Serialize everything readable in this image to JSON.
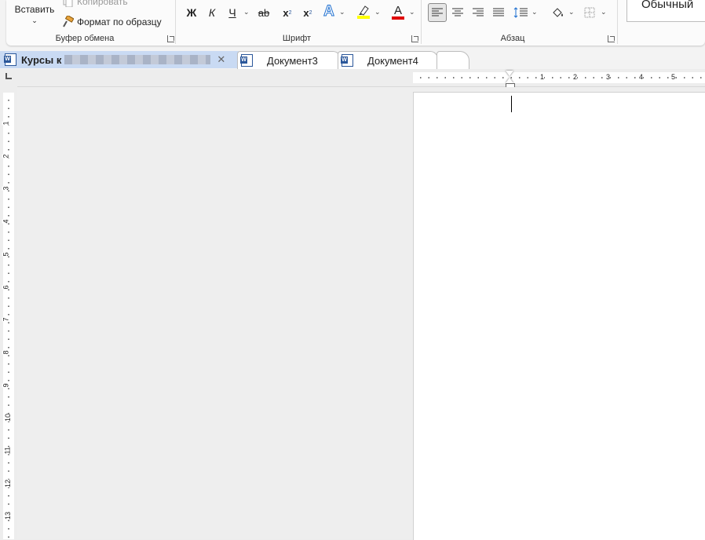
{
  "ribbon": {
    "clipboard": {
      "paste_label": "Вставить",
      "copy_label": "Копировать",
      "format_painter_label": "Формат по образцу",
      "group_label": "Буфер обмена"
    },
    "font": {
      "bold": "Ж",
      "italic": "К",
      "underline": "Ч",
      "strikethrough": "ab",
      "subscript": "x",
      "subscript_mark": "2",
      "superscript": "x",
      "superscript_mark": "2",
      "text_effects": "A",
      "font_color_letter": "A",
      "group_label": "Шрифт",
      "highlight_color": "#ffff00",
      "font_color": "#e00000"
    },
    "paragraph": {
      "group_label": "Абзац"
    },
    "styles": {
      "normal_label": "Обычный"
    }
  },
  "tabs": [
    {
      "label": "Курсы к"
    },
    {
      "label": "Документ3"
    },
    {
      "label": "Документ4"
    }
  ],
  "hruler": {
    "numbers": [
      "1",
      "2",
      "3",
      "4",
      "5"
    ]
  },
  "vruler": {
    "numbers": [
      "1",
      "2",
      "3",
      "4",
      "5",
      "6",
      "7",
      "8",
      "9",
      "10",
      "11",
      "12",
      "13"
    ]
  },
  "colors": {
    "accent": "#2b579a",
    "active_tab": "#c9daf3"
  }
}
